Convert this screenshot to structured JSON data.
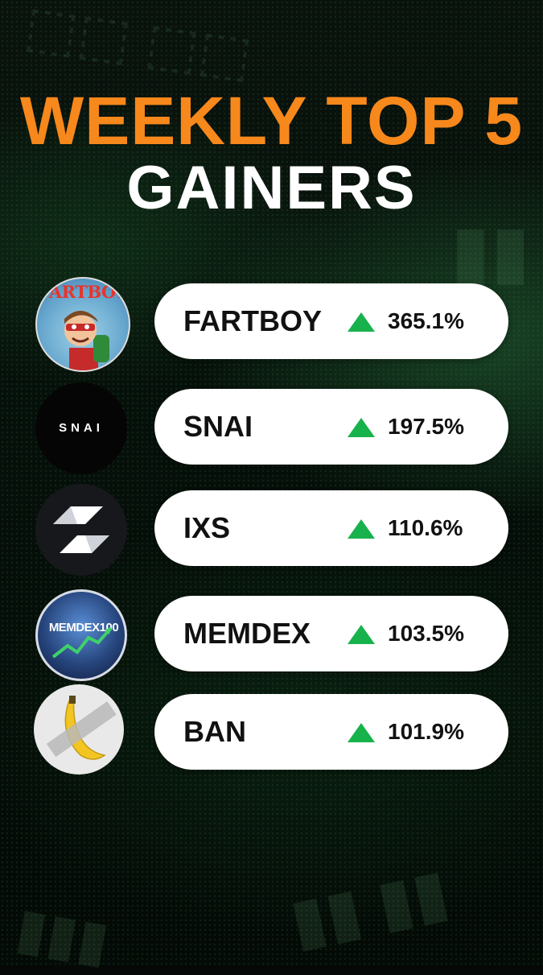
{
  "title": {
    "line1": "WEEKLY TOP 5",
    "line2": "GAINERS"
  },
  "colors": {
    "title_accent": "#f7881c",
    "title_white": "#ffffff",
    "up_arrow": "#18b24c",
    "pill_bg": "#ffffff"
  },
  "gainers": [
    {
      "ticker": "FARTBOY",
      "change": "365.1%",
      "direction": "up-arrow-icon",
      "logo": "fartboy-cartoon-logo",
      "logo_text": "FARTBOY"
    },
    {
      "ticker": "SNAI",
      "change": "197.5%",
      "direction": "up-arrow-icon",
      "logo": "snai-logo",
      "logo_text": "SNAI"
    },
    {
      "ticker": "IXS",
      "change": "110.6%",
      "direction": "up-arrow-icon",
      "logo": "ixs-logo"
    },
    {
      "ticker": "MEMDEX",
      "change": "103.5%",
      "direction": "up-arrow-icon",
      "logo": "memdex100-logo",
      "logo_text": "MEMDEX100"
    },
    {
      "ticker": "BAN",
      "change": "101.9%",
      "direction": "up-arrow-icon",
      "logo": "banana-taped-logo"
    }
  ]
}
